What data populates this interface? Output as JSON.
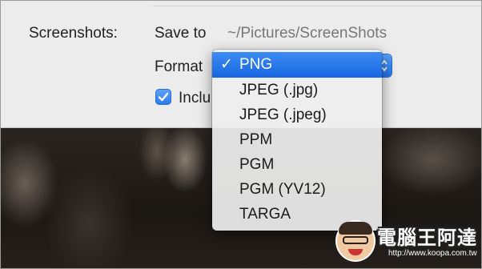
{
  "settings": {
    "section_label": "Screenshots:",
    "save_to_label": "Save to",
    "save_to_path": "~/Pictures/ScreenShots",
    "format_label": "Format",
    "include_label": "Inclu",
    "include_checked": true
  },
  "format_menu": {
    "selected": "PNG",
    "items": [
      "PNG",
      "JPEG (.jpg)",
      "JPEG (.jpeg)",
      "PPM",
      "PGM",
      "PGM (YV12)",
      "TARGA"
    ],
    "checkmark": "✓"
  },
  "watermark": {
    "title": "電腦王阿達",
    "url": "http://www.koopa.com.tw"
  },
  "colors": {
    "accent": "#2b79ea",
    "panel": "#ececec"
  }
}
